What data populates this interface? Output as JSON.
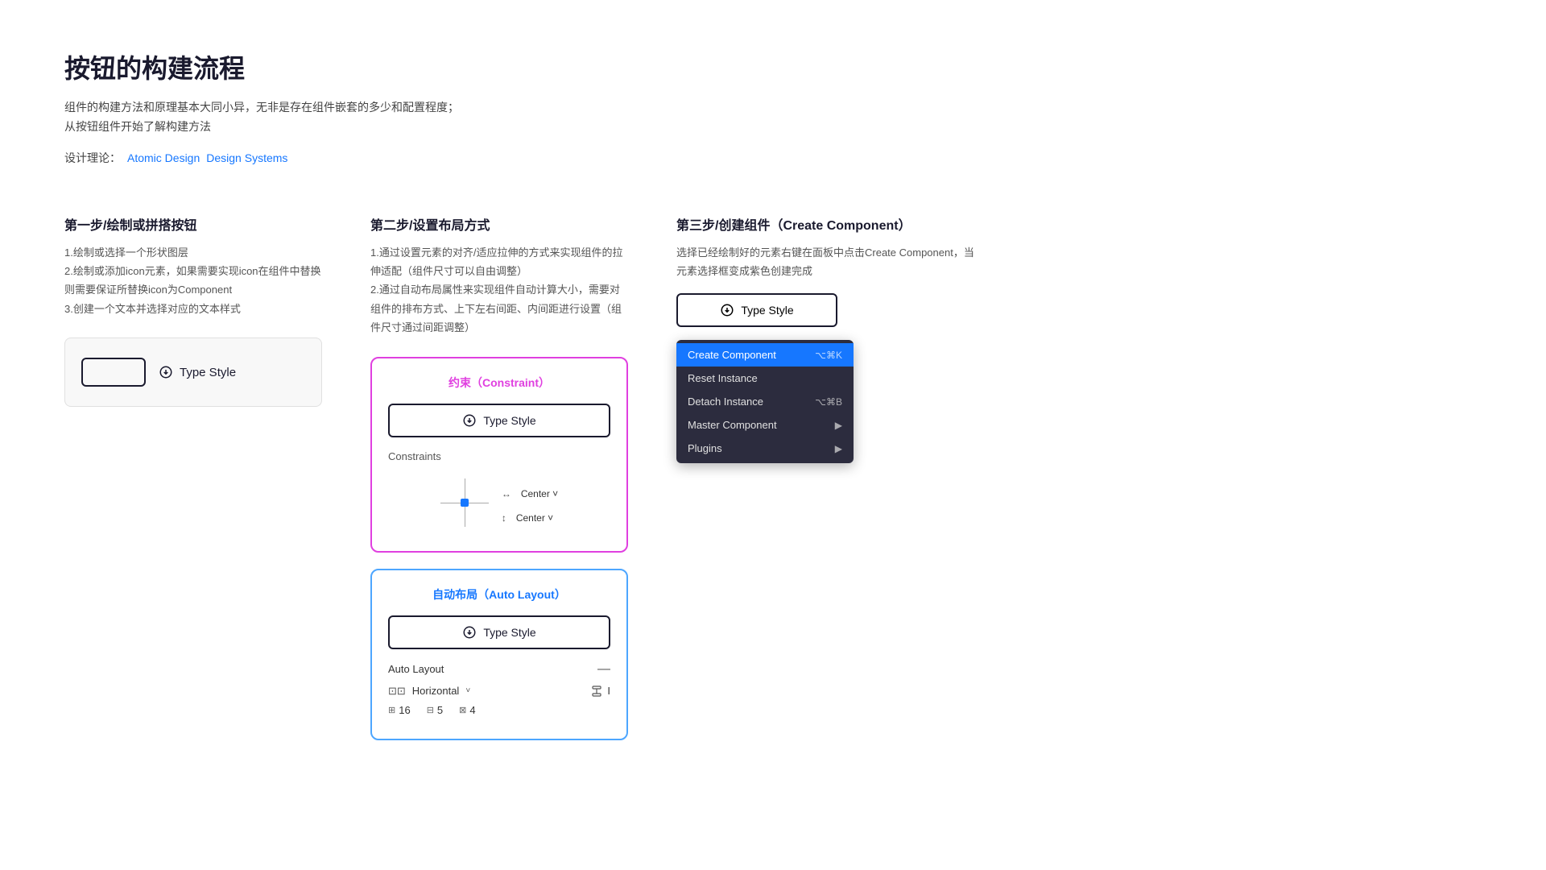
{
  "page": {
    "title": "按钮的构建流程",
    "description": "组件的构建方法和原理基本大同小异，无非是存在组件嵌套的多少和配置程度；从按钮组件开始了解构建方法",
    "theory_label": "设计理论：",
    "theory_links": [
      {
        "text": "Atomic Design",
        "href": "#"
      },
      {
        "text": "Design Systems",
        "href": "#"
      }
    ]
  },
  "step1": {
    "title": "第一步/绘制或拼搭按钮",
    "desc_lines": [
      "1.绘制或选择一个形状图层",
      "2.绘制或添加icon元素，如果需要实现icon在组件中替换则需要保证所替换icon为Component",
      "3.创建一个文本并选择对应的文本样式"
    ],
    "type_style_label": "Type Style",
    "button_text": "Type Style"
  },
  "step2": {
    "title": "第二步/设置布局方式",
    "desc_lines": [
      "1.通过设置元素的对齐/适应拉伸的方式来实现组件的拉伸适配（组件尺寸可以自由调整）",
      "2.通过自动布局属性来实现组件自动计算大小，需要对组件的排布方式、上下左右间距、内间距进行设置（组件尺寸通过间距调整）"
    ],
    "constraint_card": {
      "title": "约束（Constraint）",
      "button_label": "Type Style",
      "constraints_label": "Constraints",
      "h_label": "↔",
      "h_value": "Center",
      "v_label": "↕",
      "v_value": "Center"
    },
    "autolayout_card": {
      "title": "自动布局（Auto Layout）",
      "button_label": "Type Style",
      "auto_layout_label": "Auto Layout",
      "direction": "Horizontal",
      "v_padding_val": "",
      "h_padding_val": "",
      "spacing_val": "",
      "val1": "16",
      "val2": "5",
      "val3": "4"
    }
  },
  "step3": {
    "title": "第三步/创建组件（Create Component）",
    "desc": "选择已经绘制好的元素右键在面板中点击Create Component，当元素选择框变成紫色创建完成",
    "button_label": "Type Style",
    "context_menu": {
      "items": [
        {
          "label": "Create Component",
          "shortcut": "⌥⌘K",
          "active": true
        },
        {
          "label": "Reset Instance",
          "shortcut": "",
          "active": false
        },
        {
          "label": "Detach Instance",
          "shortcut": "⌥⌘B",
          "active": false
        },
        {
          "label": "Master Component",
          "shortcut": "▶",
          "active": false
        },
        {
          "label": "Plugins",
          "shortcut": "▶",
          "active": false
        }
      ]
    }
  }
}
